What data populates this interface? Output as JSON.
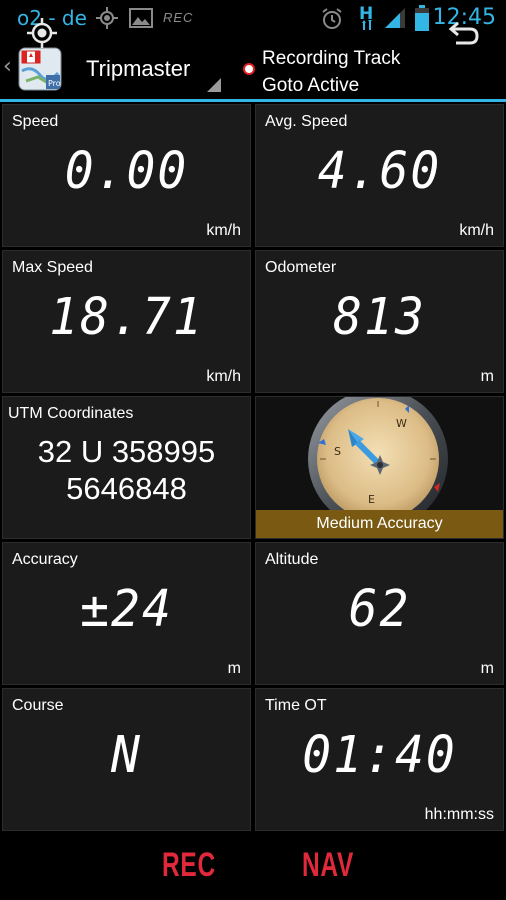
{
  "status_bar": {
    "carrier": "o2 - de",
    "rec_indicator": "REC",
    "time": "12:45",
    "icons": [
      "gps-icon",
      "image-icon",
      "rec-icon",
      "alarm-icon",
      "hspa-icon",
      "signal-icon",
      "battery-icon"
    ],
    "accent_color": "#33b5e5"
  },
  "action_bar": {
    "title": "Tripmaster",
    "status_line1": "Recording Track",
    "status_line2": "Goto Active",
    "recording_dot_color": "#e02020"
  },
  "tiles": {
    "speed": {
      "label": "Speed",
      "value": "0.00",
      "unit": "km/h"
    },
    "avg_speed": {
      "label": "Avg. Speed",
      "value": "4.60",
      "unit": "km/h"
    },
    "max_speed": {
      "label": "Max Speed",
      "value": "18.71",
      "unit": "km/h"
    },
    "odometer": {
      "label": "Odometer",
      "value": "813",
      "unit": "m"
    },
    "utm": {
      "label": "UTM Coordinates",
      "line1": "32 U 358995",
      "line2": "5646848"
    },
    "compass": {
      "accuracy_text": "Medium Accuracy",
      "letters": [
        "W",
        "S",
        "E"
      ],
      "band_color": "#7a5a12"
    },
    "accuracy": {
      "label": "Accuracy",
      "value": "±24",
      "unit": "m"
    },
    "altitude": {
      "label": "Altitude",
      "value": "62",
      "unit": "m"
    },
    "course": {
      "label": "Course",
      "value": "N"
    },
    "time_ot": {
      "label": "Time OT",
      "value": "01:40",
      "unit": "hh:mm:ss"
    }
  },
  "bottom_bar": {
    "rec_label": "REC",
    "nav_label": "NAV",
    "label_color": "#e0293a"
  }
}
